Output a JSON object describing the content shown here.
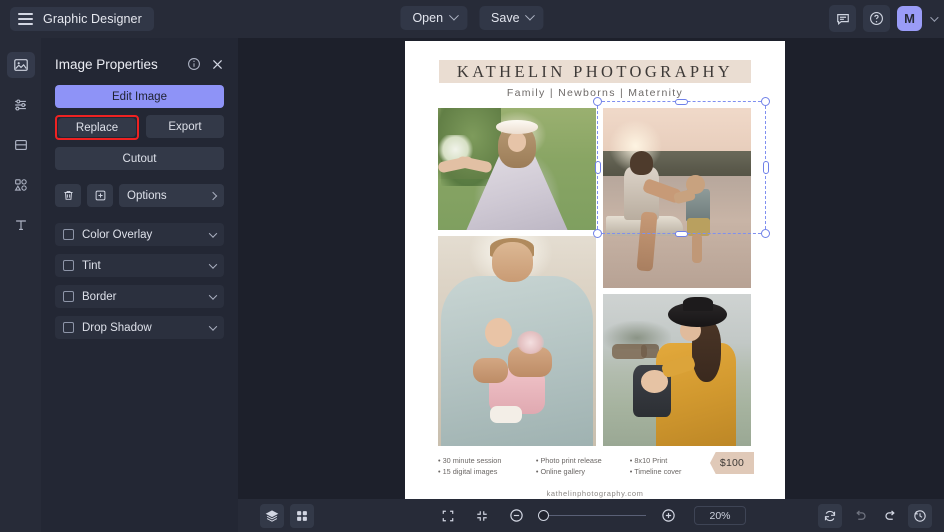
{
  "app": {
    "name": "Graphic Designer",
    "menu_icon": "hamburger-icon"
  },
  "topbar": {
    "open_label": "Open",
    "save_label": "Save",
    "comment_icon": "comment-icon",
    "help_icon": "help-circle-icon",
    "avatar_initial": "M",
    "avatar_color": "#9a9cf7"
  },
  "rail": {
    "items": [
      {
        "name": "image-tool",
        "icon": "image-icon"
      },
      {
        "name": "adjustments-tool",
        "icon": "sliders-icon"
      },
      {
        "name": "layout-tool",
        "icon": "frame-icon"
      },
      {
        "name": "shapes-tool",
        "icon": "shapes-icon"
      },
      {
        "name": "text-tool",
        "icon": "text-icon"
      }
    ]
  },
  "panel": {
    "title": "Image Properties",
    "info_icon": "info-circle-icon",
    "close_icon": "close-icon",
    "edit_label": "Edit Image",
    "replace_label": "Replace",
    "export_label": "Export",
    "cutout_label": "Cutout",
    "highlight_color": "#ef2222",
    "primary_color": "#8e93f7",
    "delete_icon": "trash-icon",
    "duplicate_icon": "duplicate-icon",
    "options_label": "Options",
    "effects": [
      {
        "label": "Color Overlay",
        "checked": false
      },
      {
        "label": "Tint",
        "checked": false
      },
      {
        "label": "Border",
        "checked": false
      },
      {
        "label": "Drop Shadow",
        "checked": false
      }
    ]
  },
  "poster": {
    "title": "KATHELIN PHOTOGRAPHY",
    "subtitle": "Family  |  Newborns  |  Maternity",
    "bullets": {
      "col1": [
        "30 minute session",
        "15 digital images"
      ],
      "col2": [
        "Photo print release",
        "Online gallery"
      ],
      "col3": [
        "8x10 Print",
        "Timeline cover"
      ]
    },
    "price": "$100",
    "website": "kathelinphotography.com",
    "photos": [
      {
        "name": "photo-girl-white-dress"
      },
      {
        "name": "photo-mother-child-lake"
      },
      {
        "name": "photo-father-newborn"
      },
      {
        "name": "photo-woman-yellow-sweater"
      }
    ]
  },
  "bottombar": {
    "layers_icon": "layers-icon",
    "grid_icon": "grid-icon",
    "fit_icon": "fit-screen-icon",
    "collapse_icon": "collapse-icon",
    "zoom_out_icon": "zoom-out-icon",
    "zoom_in_icon": "zoom-in-icon",
    "zoom_value": "20%",
    "refresh_icon": "refresh-icon",
    "undo_icon": "undo-icon",
    "redo_icon": "redo-icon",
    "history_icon": "history-icon"
  }
}
